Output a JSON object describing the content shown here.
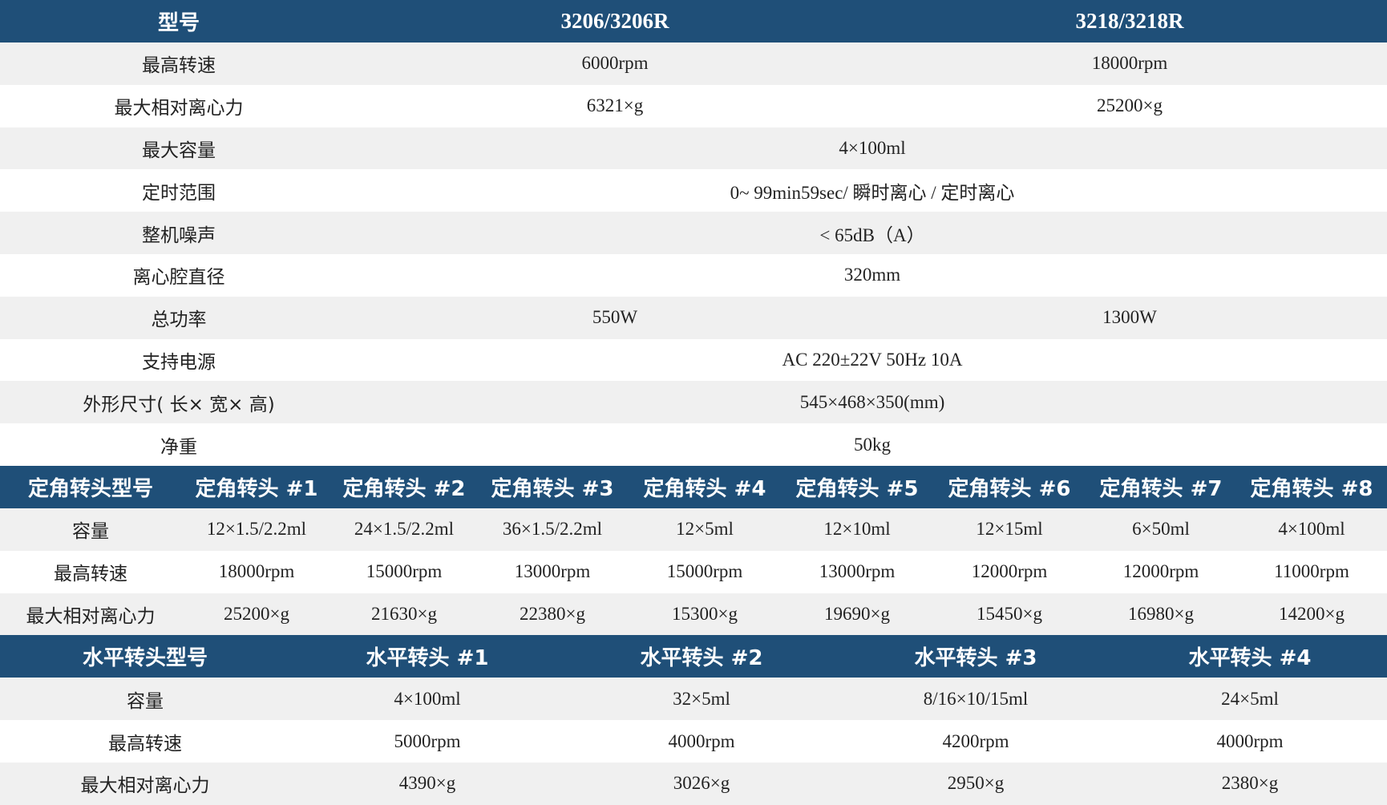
{
  "spec_table": {
    "header": [
      "型号",
      "3206/3206R",
      "3218/3218R"
    ],
    "rows": [
      {
        "label": "最高转速",
        "cells": [
          "6000rpm",
          "18000rpm"
        ],
        "span": false
      },
      {
        "label": "最大相对离心力",
        "cells": [
          "6321×g",
          "25200×g"
        ],
        "span": false
      },
      {
        "label": "最大容量",
        "cells": [
          "4×100ml"
        ],
        "span": true
      },
      {
        "label": "定时范围",
        "cells": [
          "0~ 99min59sec/ 瞬时离心 / 定时离心"
        ],
        "span": true
      },
      {
        "label": "整机噪声",
        "cells": [
          "< 65dB（A）"
        ],
        "span": true
      },
      {
        "label": "离心腔直径",
        "cells": [
          "320mm"
        ],
        "span": true
      },
      {
        "label": "总功率",
        "cells": [
          "550W",
          "1300W"
        ],
        "span": false
      },
      {
        "label": "支持电源",
        "cells": [
          "AC 220±22V 50Hz 10A"
        ],
        "span": true
      },
      {
        "label": "外形尺寸( 长× 宽× 高)",
        "cells": [
          "545×468×350(mm)"
        ],
        "span": true
      },
      {
        "label": "净重",
        "cells": [
          "50kg"
        ],
        "span": true
      }
    ]
  },
  "fixed_angle_table": {
    "header": [
      "定角转头型号",
      "定角转头 #1",
      "定角转头 #2",
      "定角转头 #3",
      "定角转头 #4",
      "定角转头 #5",
      "定角转头 #6",
      "定角转头 #7",
      "定角转头 #8"
    ],
    "rows": [
      {
        "label": "容量",
        "cells": [
          "12×1.5/2.2ml",
          "24×1.5/2.2ml",
          "36×1.5/2.2ml",
          "12×5ml",
          "12×10ml",
          "12×15ml",
          "6×50ml",
          "4×100ml"
        ]
      },
      {
        "label": "最高转速",
        "cells": [
          "18000rpm",
          "15000rpm",
          "13000rpm",
          "15000rpm",
          "13000rpm",
          "12000rpm",
          "12000rpm",
          "11000rpm"
        ]
      },
      {
        "label": "最大相对离心力",
        "cells": [
          "25200×g",
          "21630×g",
          "22380×g",
          "15300×g",
          "19690×g",
          "15450×g",
          "16980×g",
          "14200×g"
        ]
      }
    ]
  },
  "horizontal_table": {
    "header": [
      "水平转头型号",
      "水平转头 #1",
      "水平转头 #2",
      "水平转头 #3",
      "水平转头 #4"
    ],
    "rows": [
      {
        "label": "容量",
        "cells": [
          "4×100ml",
          "32×5ml",
          "8/16×10/15ml",
          "24×5ml"
        ]
      },
      {
        "label": "最高转速",
        "cells": [
          "5000rpm",
          "4000rpm",
          "4200rpm",
          "4000rpm"
        ]
      },
      {
        "label": "最大相对离心力",
        "cells": [
          "4390×g",
          "3026×g",
          "2950×g",
          "2380×g"
        ]
      }
    ]
  },
  "colors": {
    "header_bg": "#1f4f78",
    "header_text": "#ffffff",
    "row_alt_bg": "#f0f0f0",
    "row_bg": "#ffffff"
  }
}
